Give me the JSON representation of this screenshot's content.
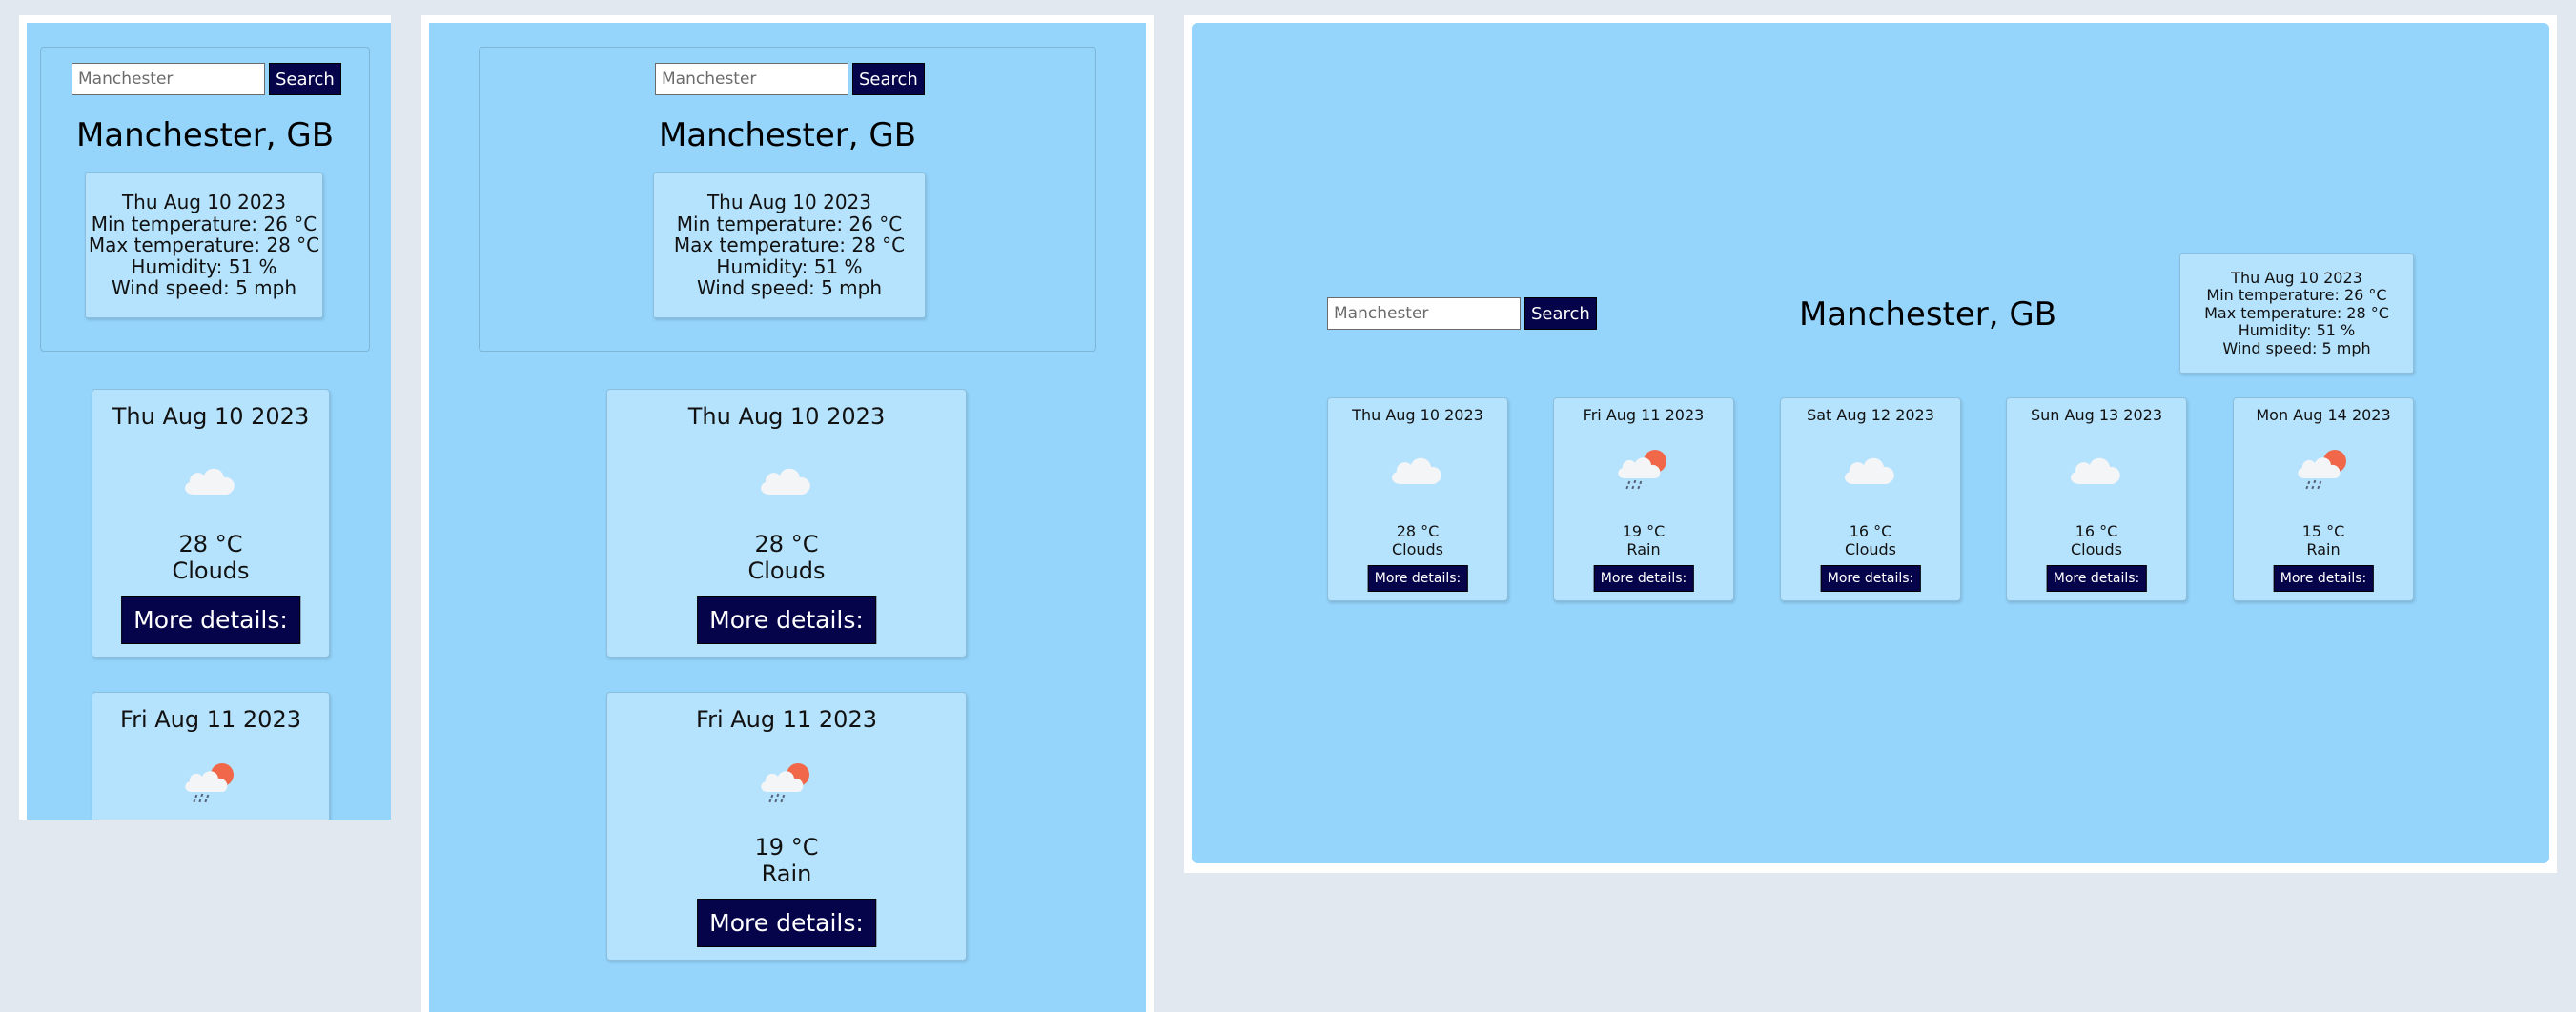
{
  "search": {
    "placeholder": "Manchester",
    "button_label": "Search"
  },
  "city": "Manchester, GB",
  "today": {
    "date": "Thu Aug 10 2023",
    "min_temp": "Min temperature: 26 °C",
    "max_temp": "Max temperature: 28 °C",
    "humidity": "Humidity: 51 %",
    "wind": "Wind speed: 5 mph"
  },
  "forecast": [
    {
      "date": "Thu Aug 10 2023",
      "icon": "clouds-icon",
      "temp": "28 °C",
      "desc": "Clouds",
      "button_label": "More details:"
    },
    {
      "date": "Fri Aug 11 2023",
      "icon": "rain-icon",
      "temp": "19 °C",
      "desc": "Rain",
      "button_label": "More details:"
    },
    {
      "date": "Sat Aug 12 2023",
      "icon": "clouds-icon",
      "temp": "16 °C",
      "desc": "Clouds",
      "button_label": "More details:"
    },
    {
      "date": "Sun Aug 13 2023",
      "icon": "clouds-icon",
      "temp": "16 °C",
      "desc": "Clouds",
      "button_label": "More details:"
    },
    {
      "date": "Mon Aug 14 2023",
      "icon": "rain-icon",
      "temp": "15 °C",
      "desc": "Rain",
      "button_label": "More details:"
    }
  ],
  "colors": {
    "accent": "#05034a",
    "background": "#95d5fc",
    "card": "#b5e2fc",
    "page": "#e2e8f0"
  }
}
